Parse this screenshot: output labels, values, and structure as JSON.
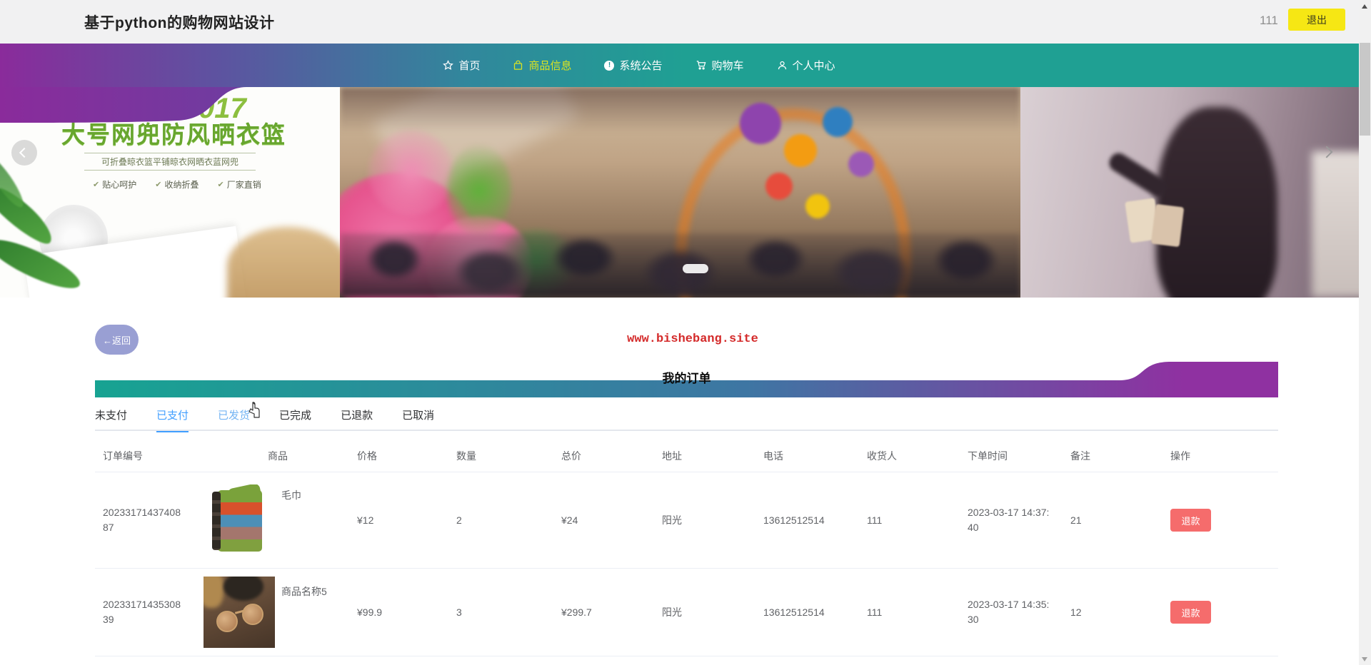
{
  "colors": {
    "nav_gradient_left": "#8a2b9b",
    "nav_gradient_right": "#1fa093",
    "nav_active": "#dce421",
    "logout_yellow": "#f6e714",
    "back_button": "#999fd3",
    "link_red": "#d42a2a",
    "tab_active_blue": "#409eff",
    "refund_red": "#f56c6c",
    "dot_purple": "#9c27b0",
    "dot_white": "#ffffff",
    "dot_yellow": "#f5e217"
  },
  "header": {
    "title": "基于python的购物网站设计",
    "user": "111",
    "logout": "退出"
  },
  "nav": {
    "items": [
      {
        "label": "首页",
        "icon": "star-icon"
      },
      {
        "label": "商品信息",
        "icon": "bag-icon"
      },
      {
        "label": "系统公告",
        "icon": "info-icon"
      },
      {
        "label": "购物车",
        "icon": "cart-icon"
      },
      {
        "label": "个人中心",
        "icon": "user-icon"
      }
    ],
    "info_glyph": "!",
    "indicator_dots": [
      "#9c27b0",
      "#ffffff",
      "#f5e217"
    ]
  },
  "carousel": {
    "left_slide": {
      "year_fragment": "017",
      "headline": "大号网兜防风晒衣篮",
      "subheadline": "可折叠晾衣篮平铺晾衣网晒衣蓝网兜",
      "check": "✔",
      "features": [
        "贴心呵护",
        "收纳折叠",
        "厂家直销"
      ]
    }
  },
  "content": {
    "back_button": "←返回",
    "site_link": "www.bishebang.site",
    "section_title": "我的订单"
  },
  "tabs": [
    {
      "label": "未支付"
    },
    {
      "label": "已支付"
    },
    {
      "label": "已发货"
    },
    {
      "label": "已完成"
    },
    {
      "label": "已退款"
    },
    {
      "label": "已取消"
    }
  ],
  "orders": {
    "columns": [
      "订单编号",
      "商品",
      "价格",
      "数量",
      "总价",
      "地址",
      "电话",
      "收货人",
      "下单时间",
      "备注",
      "操作"
    ],
    "refund_label": "退款",
    "rows": [
      {
        "order_no": "2023317143740887",
        "product": "毛巾",
        "price": "¥12",
        "quantity": "2",
        "total": "¥24",
        "address": "阳光",
        "phone": "13612512514",
        "receiver": "111",
        "time": "2023-03-17 14:37:40",
        "note": "21"
      },
      {
        "order_no": "2023317143530839",
        "product": "商品名称5",
        "price": "¥99.9",
        "quantity": "3",
        "total": "¥299.7",
        "address": "阳光",
        "phone": "13612512514",
        "receiver": "111",
        "time": "2023-03-17 14:35:30",
        "note": "12"
      }
    ]
  }
}
